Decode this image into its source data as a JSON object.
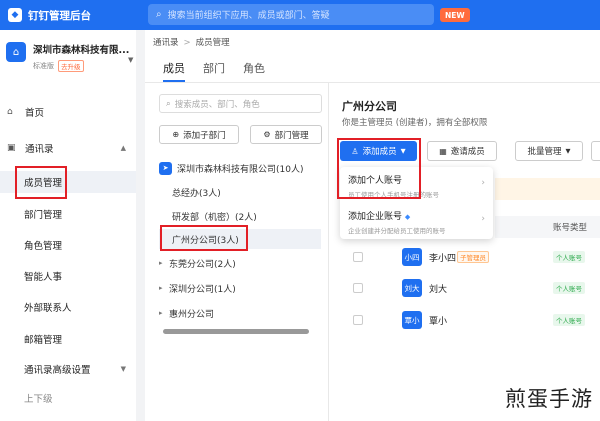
{
  "topbar": {
    "app_title": "钉钉管理后台",
    "search_placeholder": "搜索当前组织下应用、成员或部门、答疑",
    "new_badge": "NEW"
  },
  "sidebar": {
    "org_name": "深圳市森林科技有限...",
    "org_tag_standard": "标准版",
    "org_tag_upgrade": "去升级",
    "home": "首页",
    "contacts": "通讯录",
    "items": [
      "成员管理",
      "部门管理",
      "角色管理",
      "智能人事",
      "外部联系人",
      "邮箱管理",
      "通讯录高级设置",
      "上下级"
    ]
  },
  "main": {
    "breadcrumb": [
      "通讯录",
      "成员管理"
    ],
    "tabs": [
      "成员",
      "部门",
      "角色"
    ],
    "tree_search_placeholder": "搜索成员、部门、角色",
    "add_subdept": "添加子部门",
    "dept_manage": "部门管理",
    "tree": [
      {
        "label": "深圳市森林科技有限公司(10人)",
        "caret": ""
      },
      {
        "label": "总经办(3人)",
        "caret": ""
      },
      {
        "label": "研发部（机密）(2人)",
        "caret": ""
      },
      {
        "label": "广州分公司(3人)",
        "caret": ""
      },
      {
        "label": "东莞分公司(2人)",
        "caret": "▸"
      },
      {
        "label": "深圳分公司(1人)",
        "caret": "▸"
      },
      {
        "label": "惠州分公司",
        "caret": "▸"
      }
    ],
    "dept_title": "广州分公司",
    "dept_sub": "你是主管理员 (创建者)，拥有全部权限",
    "btn_add_member": "添加成员",
    "btn_invite": "邀请成员",
    "btn_batch": "批量管理",
    "col_account_type": "账号类型",
    "dropdown": [
      {
        "title": "添加个人账号",
        "desc": "员工使用个人手机号注册的账号"
      },
      {
        "title": "添加企业账号",
        "desc": "企业创建并分配给员工使用的账号"
      }
    ],
    "members": [
      {
        "avatar": "小四",
        "name": "李小四",
        "admin": "子管理员",
        "type": "个人账号"
      },
      {
        "avatar": "刘大",
        "name": "刘大",
        "admin": "",
        "type": "个人账号"
      },
      {
        "avatar": "覃小",
        "name": "覃小",
        "admin": "",
        "type": "个人账号"
      }
    ]
  },
  "watermark": "煎蛋手游",
  "colors": {
    "primary": "#1f6ff0",
    "highlight": "#e21f26",
    "new_badge": "#ff6b3d"
  }
}
